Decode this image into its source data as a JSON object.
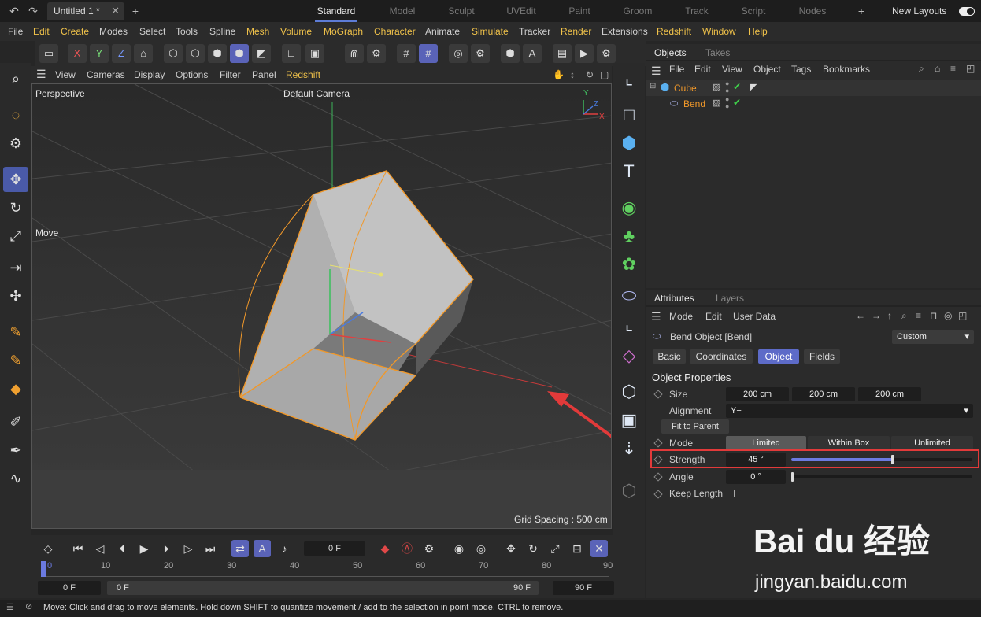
{
  "titlebar": {
    "doc_tab": "Untitled 1 *",
    "layouts": [
      "Standard",
      "Model",
      "Sculpt",
      "UVEdit",
      "Paint",
      "Groom",
      "Track",
      "Script",
      "Nodes"
    ],
    "new_layouts": "New Layouts"
  },
  "menu": [
    "File",
    "Edit",
    "Create",
    "Modes",
    "Select",
    "Tools",
    "Spline",
    "Mesh",
    "Volume",
    "MoGraph",
    "Character",
    "Animate",
    "Simulate",
    "Tracker",
    "Render",
    "Extensions",
    "Redshift",
    "Window",
    "Help"
  ],
  "toolbar": {
    "x": "X",
    "y": "Y",
    "z": "Z"
  },
  "viewport": {
    "menu": [
      "View",
      "Cameras",
      "Display",
      "Options",
      "Filter",
      "Panel",
      "Redshift"
    ],
    "name": "Perspective",
    "camera": "Default Camera",
    "move_label": "Move",
    "grid_spacing": "Grid Spacing : 500 cm",
    "axis_x": "X",
    "axis_y": "Y",
    "axis_z": "Z",
    "colors": {
      "selection": "#f0982a",
      "x_axis": "#e04040",
      "y_axis": "#40c060",
      "z_axis": "#4a7be0",
      "arrow": "#e23a3a"
    }
  },
  "timeline": {
    "current_frame": "0 F",
    "ticks": [
      "0",
      "10",
      "20",
      "30",
      "40",
      "50",
      "60",
      "70",
      "80",
      "90"
    ],
    "start": "0 F",
    "range_start": "0 F",
    "range_end": "90 F",
    "end": "90 F"
  },
  "objects": {
    "tabs": [
      "Objects",
      "Takes"
    ],
    "menu": [
      "File",
      "Edit",
      "View",
      "Object",
      "Tags",
      "Bookmarks"
    ],
    "items": [
      {
        "name": "Cube"
      },
      {
        "name": "Bend"
      }
    ]
  },
  "attributes": {
    "tabs": [
      "Attributes",
      "Layers"
    ],
    "menu": [
      "Mode",
      "Edit",
      "User Data"
    ],
    "object_title": "Bend Object [Bend]",
    "preset": "Custom",
    "subtabs": [
      "Basic",
      "Coordinates",
      "Object",
      "Fields"
    ],
    "section": "Object Properties",
    "size_label": "Size",
    "size": [
      "200 cm",
      "200 cm",
      "200 cm"
    ],
    "alignment_label": "Alignment",
    "alignment": "Y+",
    "fit_to_parent": "Fit to Parent",
    "mode_label": "Mode",
    "modes": [
      "Limited",
      "Within Box",
      "Unlimited"
    ],
    "strength_label": "Strength",
    "strength": "45 °",
    "strength_fraction": 0.56,
    "angle_label": "Angle",
    "angle": "0 °",
    "keep_length_label": "Keep Length"
  },
  "status": "Move: Click and drag to move elements. Hold down SHIFT to quantize movement / add to the selection in point mode, CTRL to remove.",
  "watermark": {
    "brand": "Bai du 经验",
    "url": "jingyan.baidu.com"
  }
}
